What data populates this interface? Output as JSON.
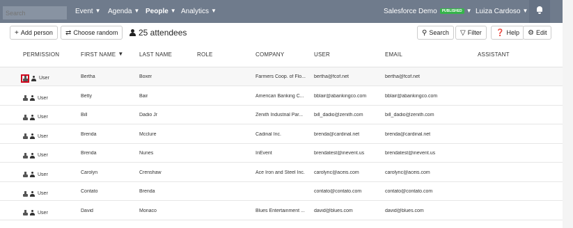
{
  "topbar": {
    "search_placeholder": "Search",
    "nav": [
      {
        "label": "Event",
        "active": false
      },
      {
        "label": "Agenda",
        "active": false
      },
      {
        "label": "People",
        "active": true
      },
      {
        "label": "Analytics",
        "active": false
      }
    ],
    "event_name": "Salesforce Demo",
    "event_badge": "PUBLISHED",
    "user_name": "Luiza Cardoso",
    "bell_icon": "bell-icon"
  },
  "toolbar": {
    "add_person": "Add person",
    "choose_random": "Choose random",
    "attendees": "25 attendees",
    "search": "Search",
    "filter": "Filter",
    "help": "Help",
    "edit": "Edit"
  },
  "table": {
    "headers": {
      "permission": "PERMISSION",
      "first_name": "FIRST NAME",
      "last_name": "LAST NAME",
      "role": "ROLE",
      "company": "COMPANY",
      "user": "USER",
      "email": "EMAIL",
      "assistant": "ASSISTANT"
    },
    "rows": [
      {
        "permission": "User",
        "first": "Bertha",
        "last": "Boxer",
        "role": "",
        "company": "Farmers Coop. of Flo...",
        "user": "bertha@fcof.net",
        "email": "bertha@fcof.net",
        "assistant": ""
      },
      {
        "permission": "User",
        "first": "Betty",
        "last": "Bair",
        "role": "",
        "company": "American Banking C...",
        "user": "bblair@abankingco.com",
        "email": "bblair@abankingco.com",
        "assistant": ""
      },
      {
        "permission": "User",
        "first": "Bill",
        "last": "Dadio Jr",
        "role": "",
        "company": "Zenith Industrial Par...",
        "user": "bill_dadio@zenith.com",
        "email": "bill_dadio@zenith.com",
        "assistant": ""
      },
      {
        "permission": "User",
        "first": "Brenda",
        "last": "Mcclure",
        "role": "",
        "company": "Cadinal Inc.",
        "user": "brenda@cardinal.net",
        "email": "brenda@cardinal.net",
        "assistant": ""
      },
      {
        "permission": "User",
        "first": "Brenda",
        "last": "Nunes",
        "role": "",
        "company": "InEvent",
        "user": "brendatest@inevent.us",
        "email": "brendatest@inevent.us",
        "assistant": ""
      },
      {
        "permission": "User",
        "first": "Carolyn",
        "last": "Crenshaw",
        "role": "",
        "company": "Ace Iron and Steel Inc.",
        "user": "carolync@aceis.com",
        "email": "carolync@aceis.com",
        "assistant": ""
      },
      {
        "permission": "User",
        "first": "Contato",
        "last": "Brenda",
        "role": "",
        "company": "",
        "user": "contato@contato.com",
        "email": "contato@contato.com",
        "assistant": ""
      },
      {
        "permission": "User",
        "first": "David",
        "last": "Monaco",
        "role": "",
        "company": "Blues Entertainment ...",
        "user": "david@blues.com",
        "email": "david@blues.com",
        "assistant": ""
      }
    ]
  },
  "colors": {
    "topbar": "#6f7b8c",
    "highlight_border": "#d0021b",
    "badge": "#35b44a"
  }
}
